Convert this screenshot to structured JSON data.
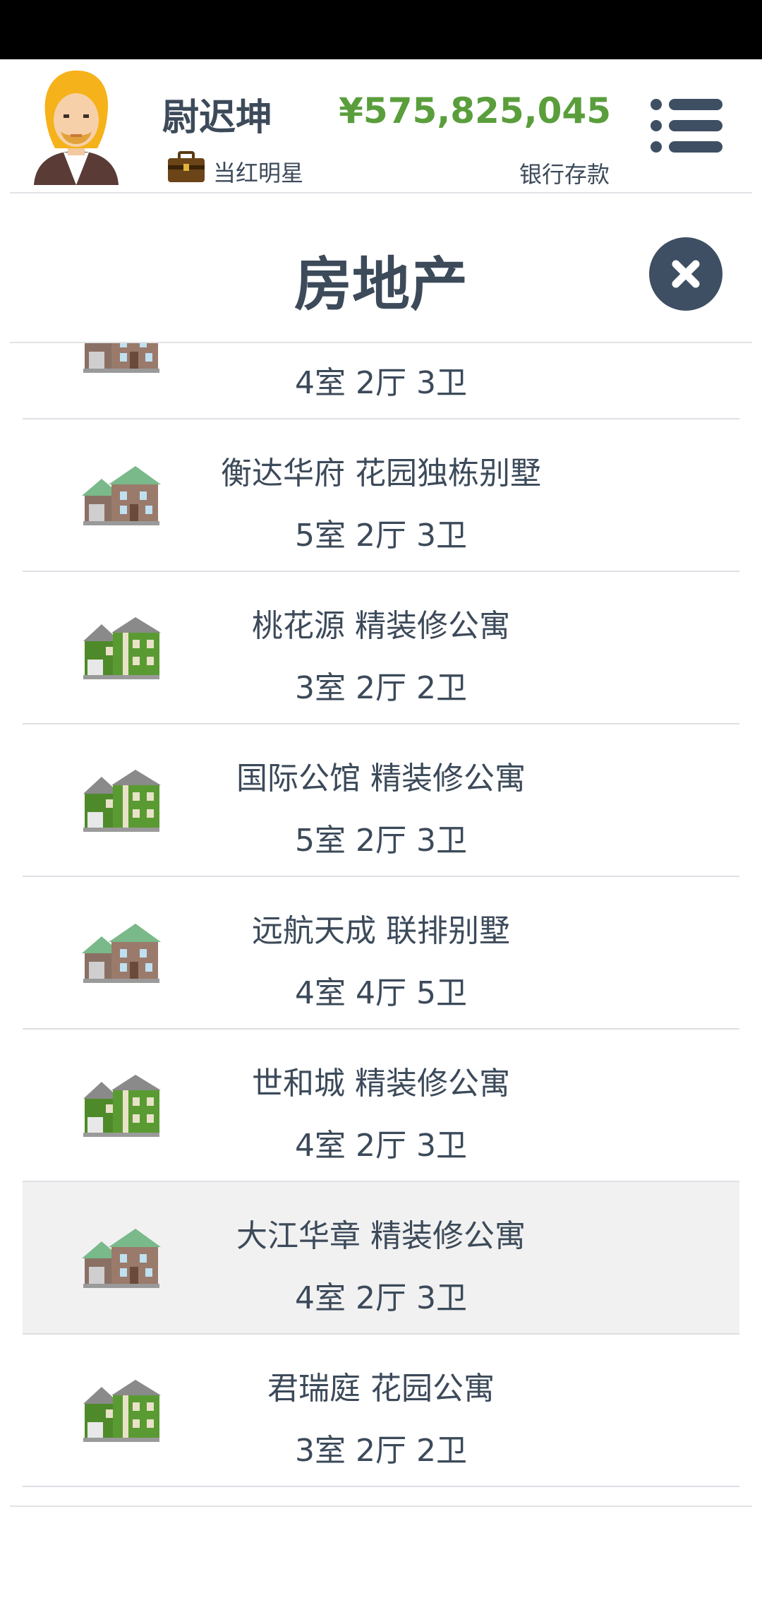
{
  "header": {
    "player_name": "尉迟坤",
    "job_title": "当红明星",
    "money": "¥575,825,045",
    "money_label": "银行存款",
    "avatar_icon": "blonde-man-avatar-icon",
    "job_icon": "briefcase-icon",
    "menu_icon": "menu-list-icon"
  },
  "page": {
    "title": "房地产",
    "close_icon": "close-x-icon"
  },
  "colors": {
    "text": "#3c4a5a",
    "money": "#5a9e3c",
    "close_button": "#3e4f63",
    "selected_row": "#f1f1f1"
  },
  "properties": [
    {
      "name": "",
      "rooms": "4室 2厅 3卫",
      "icon": "brown-villa-icon",
      "selected": false
    },
    {
      "name": "衡达华府 花园独栋别墅",
      "rooms": "5室 2厅 3卫",
      "icon": "brown-villa-icon",
      "selected": false
    },
    {
      "name": "桃花源 精装修公寓",
      "rooms": "3室 2厅 2卫",
      "icon": "green-apartment-icon",
      "selected": false
    },
    {
      "name": "国际公馆 精装修公寓",
      "rooms": "5室 2厅 3卫",
      "icon": "green-apartment-icon",
      "selected": false
    },
    {
      "name": "远航天成 联排别墅",
      "rooms": "4室 4厅 5卫",
      "icon": "brown-villa-icon",
      "selected": false
    },
    {
      "name": "世和城 精装修公寓",
      "rooms": "4室 2厅 3卫",
      "icon": "green-apartment-icon",
      "selected": false
    },
    {
      "name": "大江华章 精装修公寓",
      "rooms": "4室 2厅 3卫",
      "icon": "brown-villa-icon",
      "selected": true
    },
    {
      "name": "君瑞庭 花园公寓",
      "rooms": "3室 2厅 2卫",
      "icon": "green-apartment-icon",
      "selected": false
    }
  ]
}
